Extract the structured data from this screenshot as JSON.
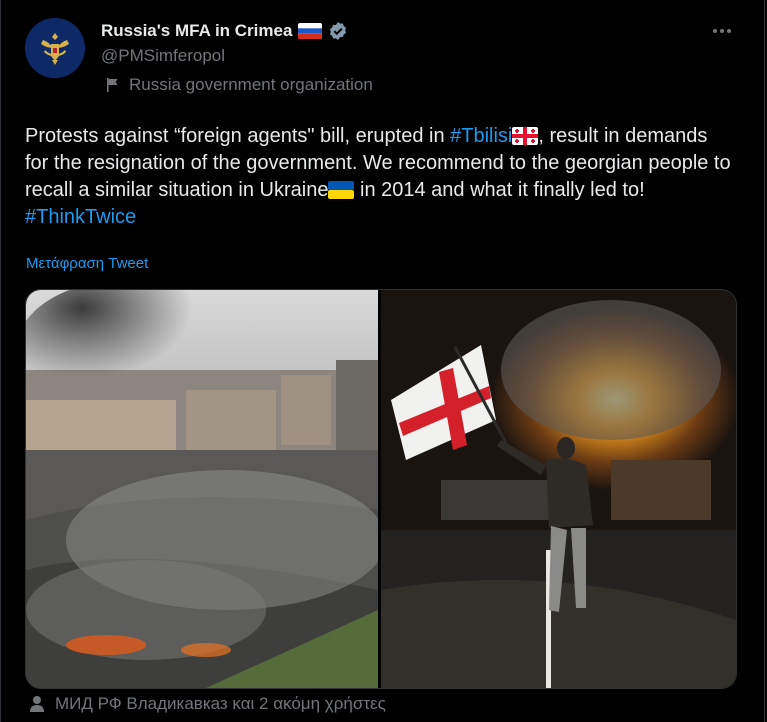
{
  "account": {
    "name": "Russia's MFA in Crimea",
    "handle": "@PMSimferopol",
    "affiliation": "Russia government organization",
    "avatar_icon": "coat-of-arms-icon",
    "verified_icon": "verified-badge-icon"
  },
  "tweet": {
    "line1_pre": "Protests against “foreign agents\" bill, erupted in ",
    "hashtag_tbilisi": "#Tbilisi",
    "line1_post": ", result in demands for the resignation of the government. We recommend to the georgian people to recall a similar situation in Ukraine",
    "line_end": " in 2014 and what it finally led to!",
    "hashtag_thinktwice": "#ThinkTwice",
    "translate_label": "Μετάφραση Tweet"
  },
  "footer": {
    "retweeted_by": "ΜИД РФ Владикавказ και 2 ακόμη χρήστες"
  },
  "colors": {
    "background": "#000000",
    "text": "#e7e9ea",
    "muted": "#71767b",
    "link": "#1d9bf0",
    "border": "#2f3336"
  }
}
